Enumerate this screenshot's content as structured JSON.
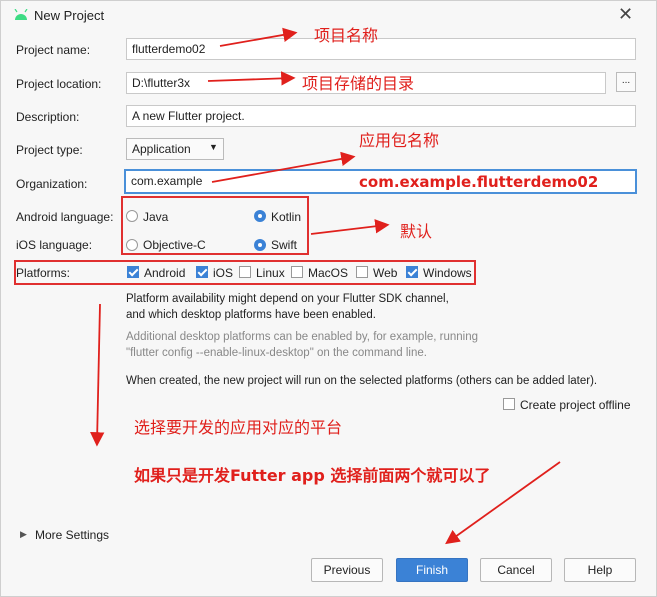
{
  "window": {
    "title": "New Project",
    "close_glyph": "✕"
  },
  "form": {
    "project_name": {
      "label": "Project name:",
      "value": "flutterdemo02"
    },
    "project_location": {
      "label": "Project location:",
      "value": "D:\\flutter3x",
      "browse": "..."
    },
    "description": {
      "label": "Description:",
      "value": "A new Flutter project."
    },
    "project_type": {
      "label": "Project type:",
      "value": "Application"
    },
    "organization": {
      "label": "Organization:",
      "value": "com.example"
    },
    "android_language": {
      "label": "Android language:",
      "options": [
        "Java",
        "Kotlin"
      ],
      "selected": "Kotlin"
    },
    "ios_language": {
      "label": "iOS language:",
      "options": [
        "Objective-C",
        "Swift"
      ],
      "selected": "Swift"
    },
    "platforms": {
      "label": "Platforms:",
      "items": [
        {
          "name": "Android",
          "checked": true
        },
        {
          "name": "iOS",
          "checked": true
        },
        {
          "name": "Linux",
          "checked": false
        },
        {
          "name": "MacOS",
          "checked": false
        },
        {
          "name": "Web",
          "checked": false
        },
        {
          "name": "Windows",
          "checked": true
        }
      ]
    }
  },
  "notes": {
    "availability_1": "Platform availability might depend on your Flutter SDK channel,",
    "availability_2": "and which desktop platforms have been enabled.",
    "additional_1": "Additional desktop platforms can be enabled by, for example, running",
    "additional_2": "\"flutter config --enable-linux-desktop\" on the command line.",
    "created": "When created, the new project will run on the selected platforms (others can be added later).",
    "offline_label": "Create project offline"
  },
  "more_settings": "More Settings",
  "buttons": {
    "previous": "Previous",
    "finish": "Finish",
    "cancel": "Cancel",
    "help": "Help"
  },
  "annotations": {
    "project_name_note": "项目名称",
    "location_note": "项目存储的目录",
    "package_note": "应用包名称",
    "package_example": "com.example.flutterdemo02",
    "default_note": "默认",
    "platform_note": "选择要开发的应用对应的平台",
    "futter_note": "如果只是开发Futter app 选择前面两个就可以了"
  },
  "colors": {
    "accent": "#3b82d6",
    "annotation_red": "#e0201c"
  }
}
